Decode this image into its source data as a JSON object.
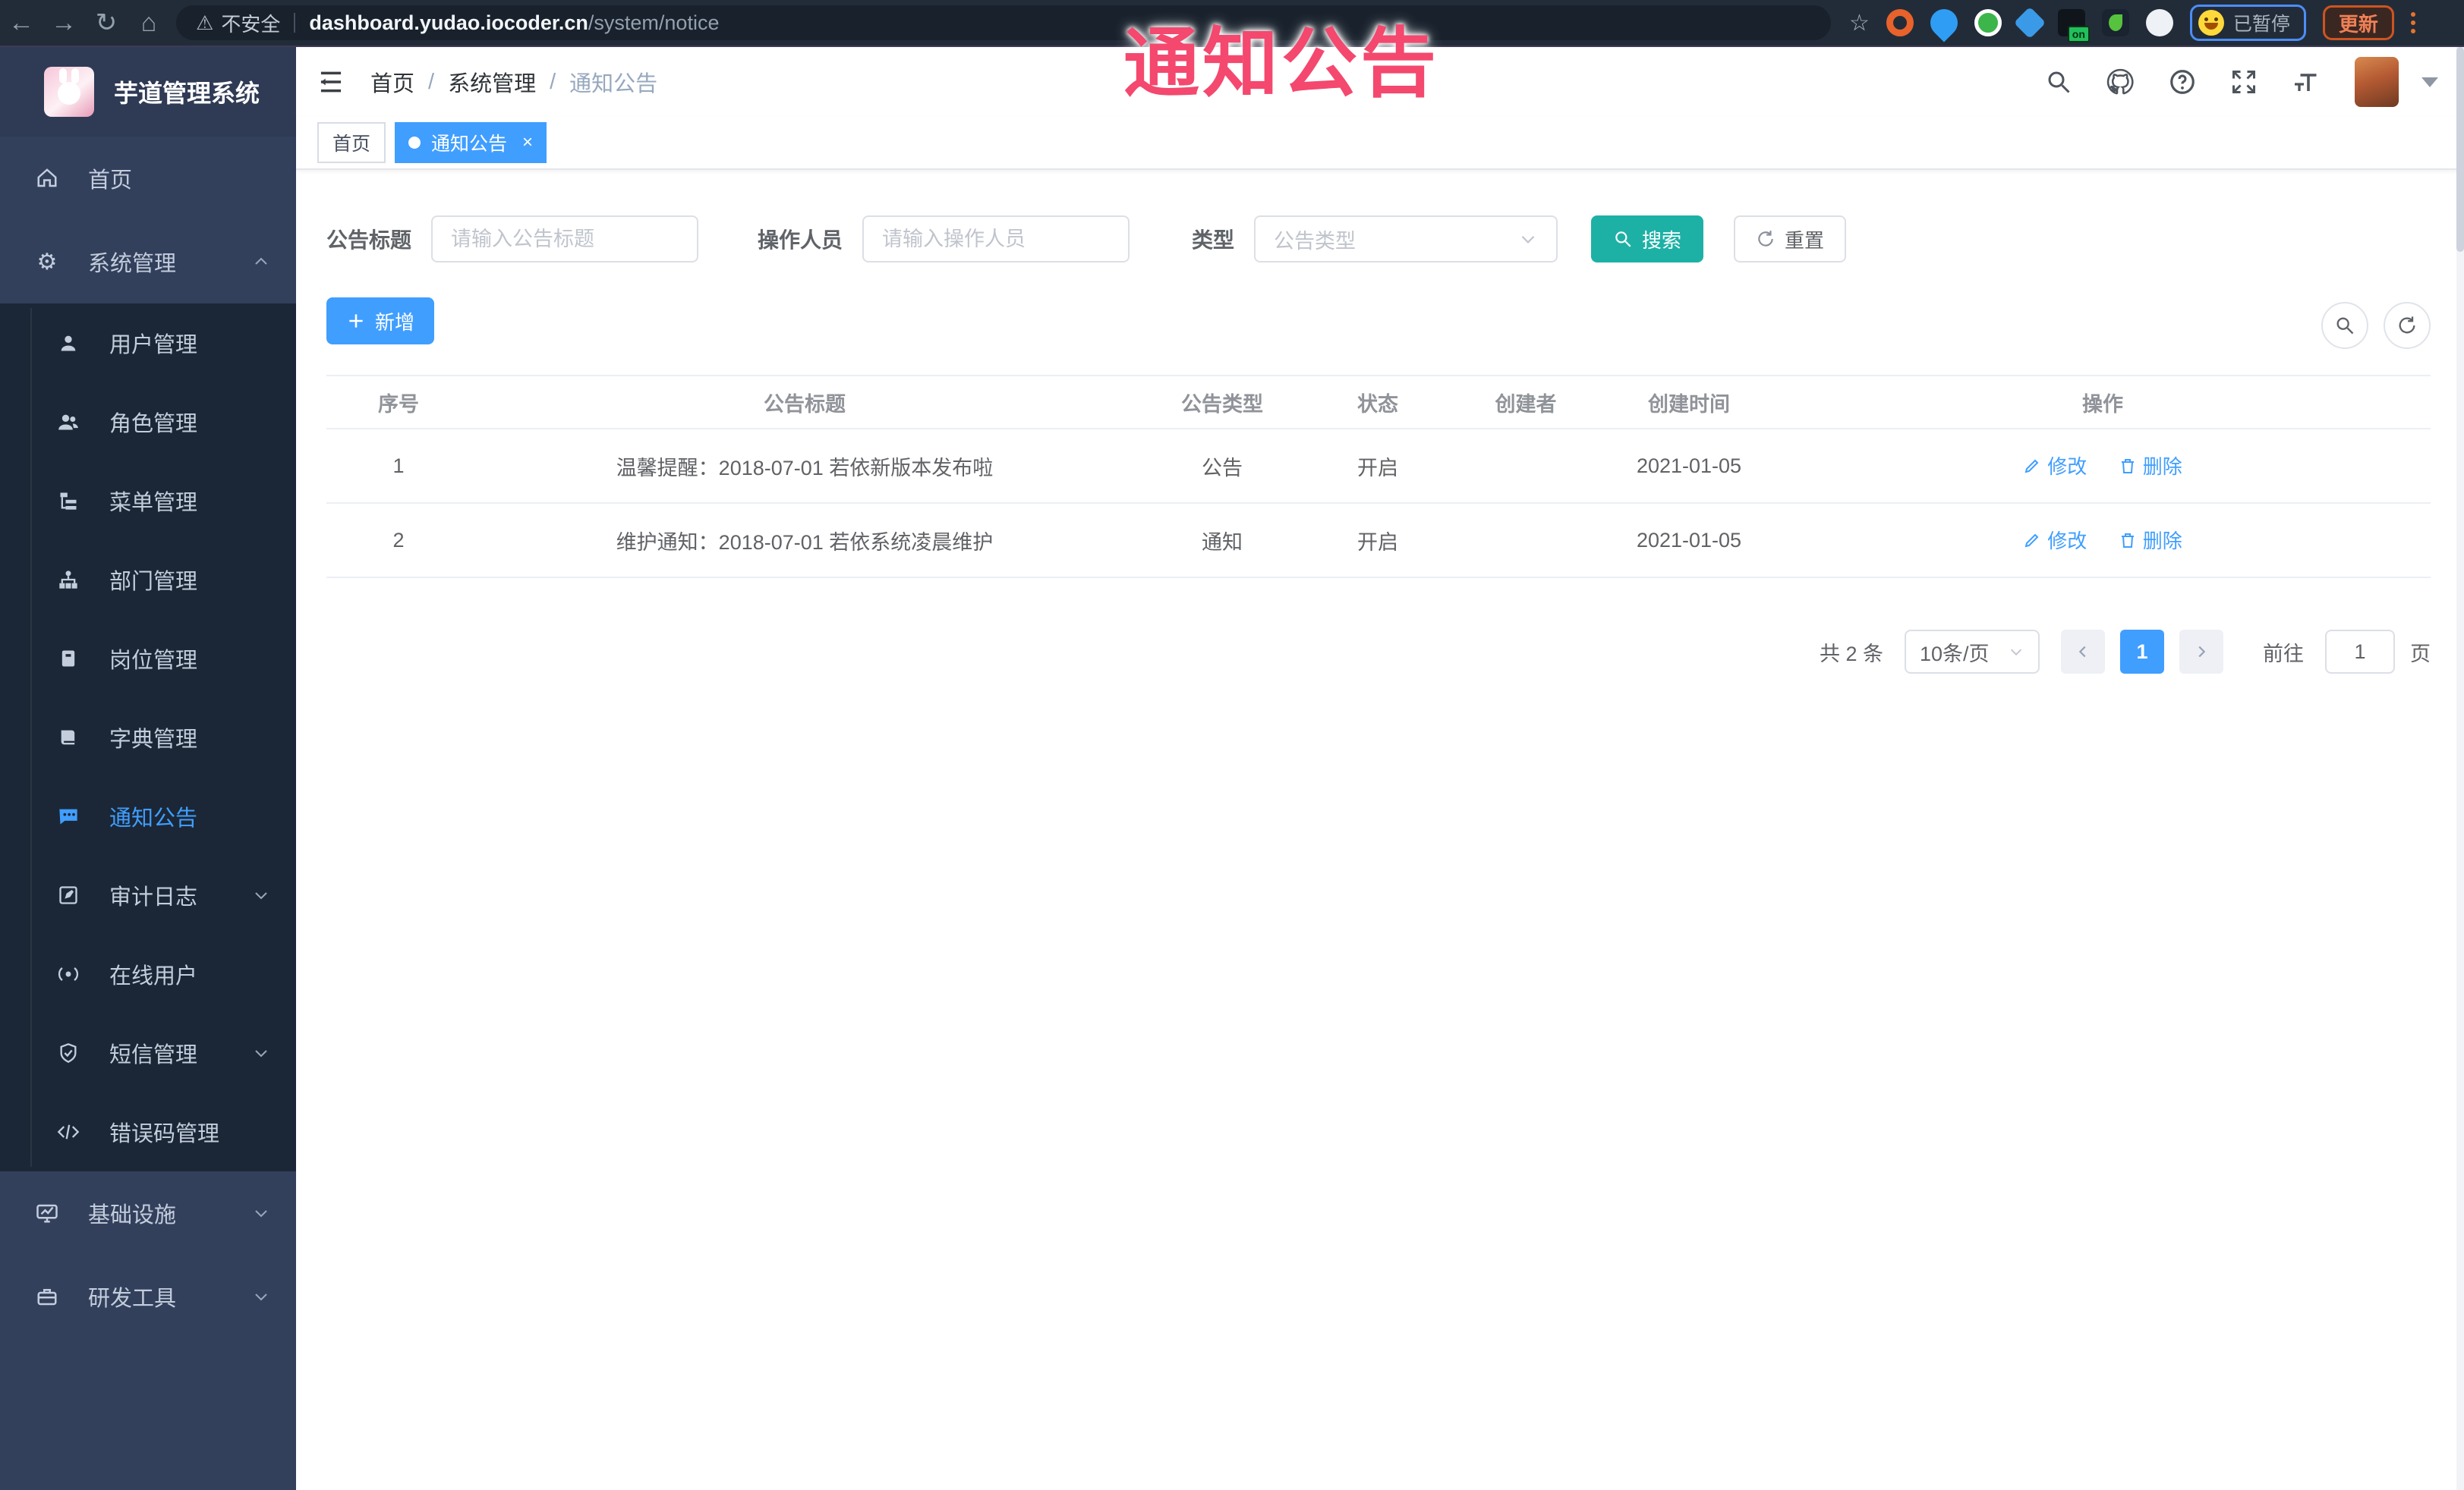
{
  "browser": {
    "security": "不安全",
    "domain": "dashboard.yudao.iocoder.cn",
    "path": "/system/notice",
    "paused": "已暂停",
    "update": "更新",
    "ext_on_badge": "on"
  },
  "watermark": "通知公告",
  "sidebar": {
    "title": "芋道管理系统",
    "menu": {
      "home": "首页",
      "system": "系统管理",
      "users": "用户管理",
      "roles": "角色管理",
      "menus": "菜单管理",
      "depts": "部门管理",
      "posts": "岗位管理",
      "dicts": "字典管理",
      "notice": "通知公告",
      "audit": "审计日志",
      "online": "在线用户",
      "sms": "短信管理",
      "errcode": "错误码管理",
      "infra": "基础设施",
      "devtools": "研发工具"
    }
  },
  "breadcrumb": {
    "items": [
      "首页",
      "系统管理",
      "通知公告"
    ],
    "separator": "/"
  },
  "tabs": {
    "home": "首页",
    "notice": "通知公告",
    "close": "×"
  },
  "filters": {
    "title_label": "公告标题",
    "title_placeholder": "请输入公告标题",
    "operator_label": "操作人员",
    "operator_placeholder": "请输入操作人员",
    "type_label": "类型",
    "type_placeholder": "公告类型",
    "search": "搜索",
    "reset": "重置"
  },
  "toolbar": {
    "add": "新增"
  },
  "table": {
    "columns": [
      "序号",
      "公告标题",
      "公告类型",
      "状态",
      "创建者",
      "创建时间",
      "操作"
    ],
    "edit": "修改",
    "delete": "删除",
    "rows": [
      {
        "no": "1",
        "title": "温馨提醒：2018-07-01 若依新版本发布啦",
        "type": "公告",
        "status": "开启",
        "creator": "",
        "created": "2021-01-05"
      },
      {
        "no": "2",
        "title": "维护通知：2018-07-01 若依系统凌晨维护",
        "type": "通知",
        "status": "开启",
        "creator": "",
        "created": "2021-01-05"
      }
    ]
  },
  "pagination": {
    "total": "共 2 条",
    "page_size": "10条/页",
    "current": "1",
    "goto_label": "前往",
    "goto_value": "1",
    "unit": "页"
  },
  "colors": {
    "primary": "#409eff",
    "teal": "#1db1a6",
    "watermark": "#f4486e"
  }
}
